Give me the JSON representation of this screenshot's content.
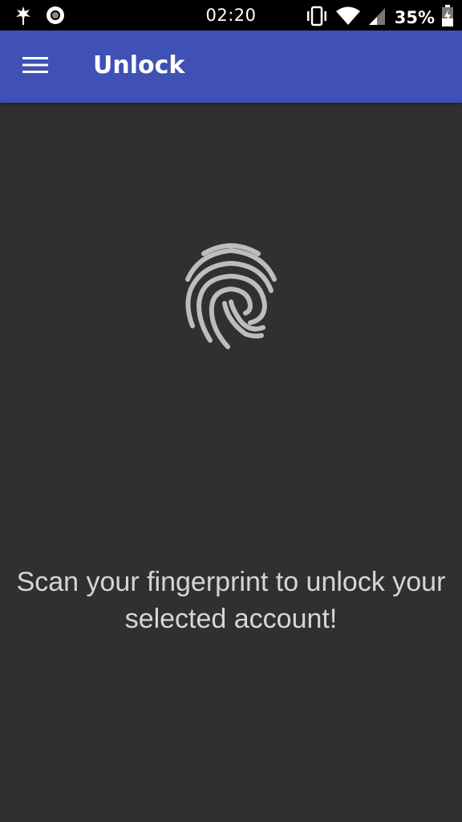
{
  "status_bar": {
    "time": "02:20",
    "battery": "35%",
    "icons": [
      "app-notification-icon",
      "sync-circle-icon",
      "vibrate-icon",
      "wifi-icon",
      "cell-signal-icon",
      "battery-charging-icon"
    ]
  },
  "app_bar": {
    "title": "Unlock",
    "menu_icon": "hamburger-menu-icon",
    "color": "#3f51b5"
  },
  "main": {
    "icon": "fingerprint-icon",
    "prompt": "Scan your fingerprint to unlock your selected account!"
  }
}
